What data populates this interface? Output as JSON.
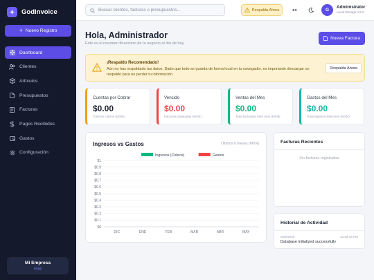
{
  "app": {
    "name": "GodInvoice",
    "new_button": "Nuevo Registro"
  },
  "sidebar": {
    "items": [
      {
        "label": "Dashboard",
        "icon": "grid-icon",
        "active": true
      },
      {
        "label": "Clientes",
        "icon": "users-icon",
        "active": false
      },
      {
        "label": "Artículos",
        "icon": "box-icon",
        "active": false
      },
      {
        "label": "Presupuestos",
        "icon": "file-icon",
        "active": false
      },
      {
        "label": "Facturas",
        "icon": "invoice-icon",
        "active": false
      },
      {
        "label": "Pagos Recibidos",
        "icon": "dollar-icon",
        "active": false
      },
      {
        "label": "Gastos",
        "icon": "wallet-icon",
        "active": false
      },
      {
        "label": "Configuración",
        "icon": "gear-icon",
        "active": false
      }
    ],
    "company": {
      "name": "Mi Empresa",
      "plan": "FREE"
    }
  },
  "topbar": {
    "search_placeholder": "Buscar clientes, facturas o presupuestos...",
    "backup_label": "Respalda Ahora",
    "language": "ES",
    "user": {
      "initial": "G",
      "name": "Administrator",
      "storage": "Local Storage V1.0"
    }
  },
  "header": {
    "title": "Hola, Administrador",
    "subtitle": "Este es el resumen financiero de tu negocio al día de hoy.",
    "new_invoice": "Nueva Factura"
  },
  "alert": {
    "title": "¡Respaldo Recomendado!",
    "text": "Aún no has respaldado tus datos. Dado que todo se guarda de forma local en tu navegador, es importante descargar un respaldo para no perder tu información.",
    "button": "Respalda Ahora"
  },
  "kpis": [
    {
      "label": "Cuentas por Cobrar",
      "value": "$0.00",
      "sub": "Total en cobros (MXN)",
      "color": "#f59e0b",
      "value_color": "#1f2433"
    },
    {
      "label": "Vencido",
      "value": "$0.00",
      "sub": "Facturas atrasadas (MXN)",
      "color": "#ef4444",
      "value_color": "#ef4444"
    },
    {
      "label": "Ventas del Mes",
      "value": "$0.00",
      "sub": "Total facturado este mes (MXN)",
      "color": "#10b981",
      "value_color": "#10b981"
    },
    {
      "label": "Gastos del Mes",
      "value": "$0.00",
      "sub": "Total egresos este mes (MXN)",
      "color": "#14b8a6",
      "value_color": "#14b8a6"
    }
  ],
  "chart": {
    "title": "Ingresos vs Gastos",
    "note": "Últimos 6 meses (MXN)"
  },
  "chart_data": {
    "type": "bar",
    "categories": [
      "DIC",
      "ENE",
      "FEB",
      "MAR",
      "ABR",
      "MAY"
    ],
    "series": [
      {
        "name": "Ingresos (Cobros)",
        "values": [
          0,
          0,
          0,
          0,
          0,
          0
        ],
        "color": "#10b981"
      },
      {
        "name": "Gastos",
        "values": [
          0,
          0,
          0,
          0,
          0,
          0
        ],
        "color": "#ef4444"
      }
    ],
    "ylim": [
      0,
      1
    ],
    "yticks": [
      "$0",
      "$0.1",
      "$0.2",
      "$0.3",
      "$0.4",
      "$0.5",
      "$0.6",
      "$0.7",
      "$0.8",
      "$0.9",
      "$1"
    ],
    "legend": "top-center",
    "grid": true
  },
  "recent": {
    "title": "Facturas Recientes",
    "empty": "Sin facturas registradas"
  },
  "activity": {
    "title": "Historial de Actividad",
    "entries": [
      {
        "date": "5/25/2026",
        "time": "10:53:48 PM",
        "text": "Database initialized successfully"
      }
    ]
  }
}
